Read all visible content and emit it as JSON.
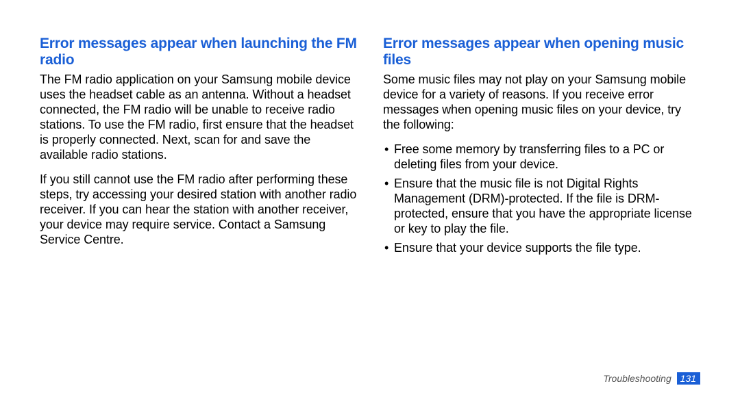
{
  "left": {
    "heading": "Error messages appear when launching the FM radio",
    "p1": "The FM radio application on your Samsung mobile device uses the headset cable as an antenna. Without a headset connected, the FM radio will be unable to receive radio stations. To use the FM radio, first ensure that the headset is properly connected. Next, scan for and save the available radio stations.",
    "p2": "If you still cannot use the FM radio after performing these steps, try accessing your desired station with another radio receiver. If you can hear the station with another receiver, your device may require service. Contact a Samsung Service Centre."
  },
  "right": {
    "heading": "Error messages appear when opening music files",
    "p1": "Some music files may not play on your Samsung mobile device for a variety of reasons. If you receive error messages when opening music files on your device, try the following:",
    "b1": "Free some memory by transferring files to a PC or deleting files from your device.",
    "b2": "Ensure that the music file is not Digital Rights Management (DRM)-protected. If the file is DRM-protected, ensure that you have the appropriate license or key to play the file.",
    "b3": "Ensure that your device supports the file type."
  },
  "footer": {
    "section": "Troubleshooting",
    "page": "131"
  }
}
